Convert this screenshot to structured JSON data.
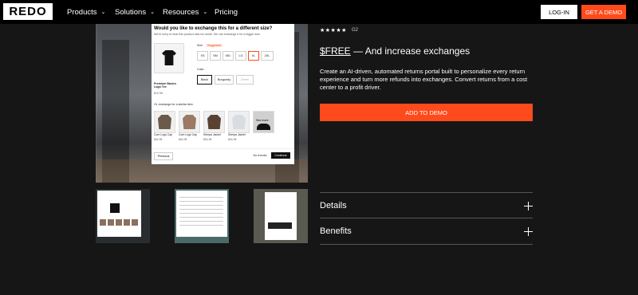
{
  "nav": {
    "logo": "REDO",
    "items": [
      {
        "label": "Products"
      },
      {
        "label": "Solutions"
      },
      {
        "label": "Resources"
      },
      {
        "label": "Pricing"
      }
    ],
    "login_label": "LOG-IN",
    "demo_label": "GET A DEMO"
  },
  "modal": {
    "title": "Would you like to exchange this for a different size?",
    "subtitle": "We're sorry to hear this product was too small. We can exchange it for a bigger size.",
    "product_name": "Premium Basics Logo Tee",
    "product_price": "$10.98",
    "size_label": "Size",
    "suggested_label": "Suggested",
    "sizes": [
      "XS",
      "SM",
      "MD",
      "LG",
      "XL",
      "2XL"
    ],
    "color_label": "Color",
    "colors": [
      "Black",
      "Burgundy",
      "Green"
    ],
    "similar_label": "Or, exchange for a similar item",
    "similar_items": [
      {
        "name": "Core Logo Cap",
        "price": "$64.98"
      },
      {
        "name": "Core Logo Cap",
        "price": "$64.98"
      },
      {
        "name": "Sherpa Jacket",
        "price": "$64.98"
      },
      {
        "name": "Sherpa Jacket",
        "price": "$64.98"
      },
      {
        "name": "See more",
        "price": ""
      }
    ],
    "previous_label": "Previous",
    "no_thanks_label": "No thanks",
    "continue_label": "Continue"
  },
  "product": {
    "stars": "★★★★★",
    "rating_source": "G2",
    "price_free": "$FREE",
    "price_rest": " — And increase exchanges",
    "description": "Create an AI-driven, automated returns portal built to personalize every return experience and turn more refunds into exchanges. Convert returns from a cost center to a profit driver.",
    "cta_label": "ADD TO DEMO",
    "accordion": [
      {
        "label": "Details"
      },
      {
        "label": "Benefits"
      }
    ]
  },
  "colors": {
    "accent": "#ff4a1c",
    "nav_bg": "#000000",
    "page_bg": "#161616"
  }
}
